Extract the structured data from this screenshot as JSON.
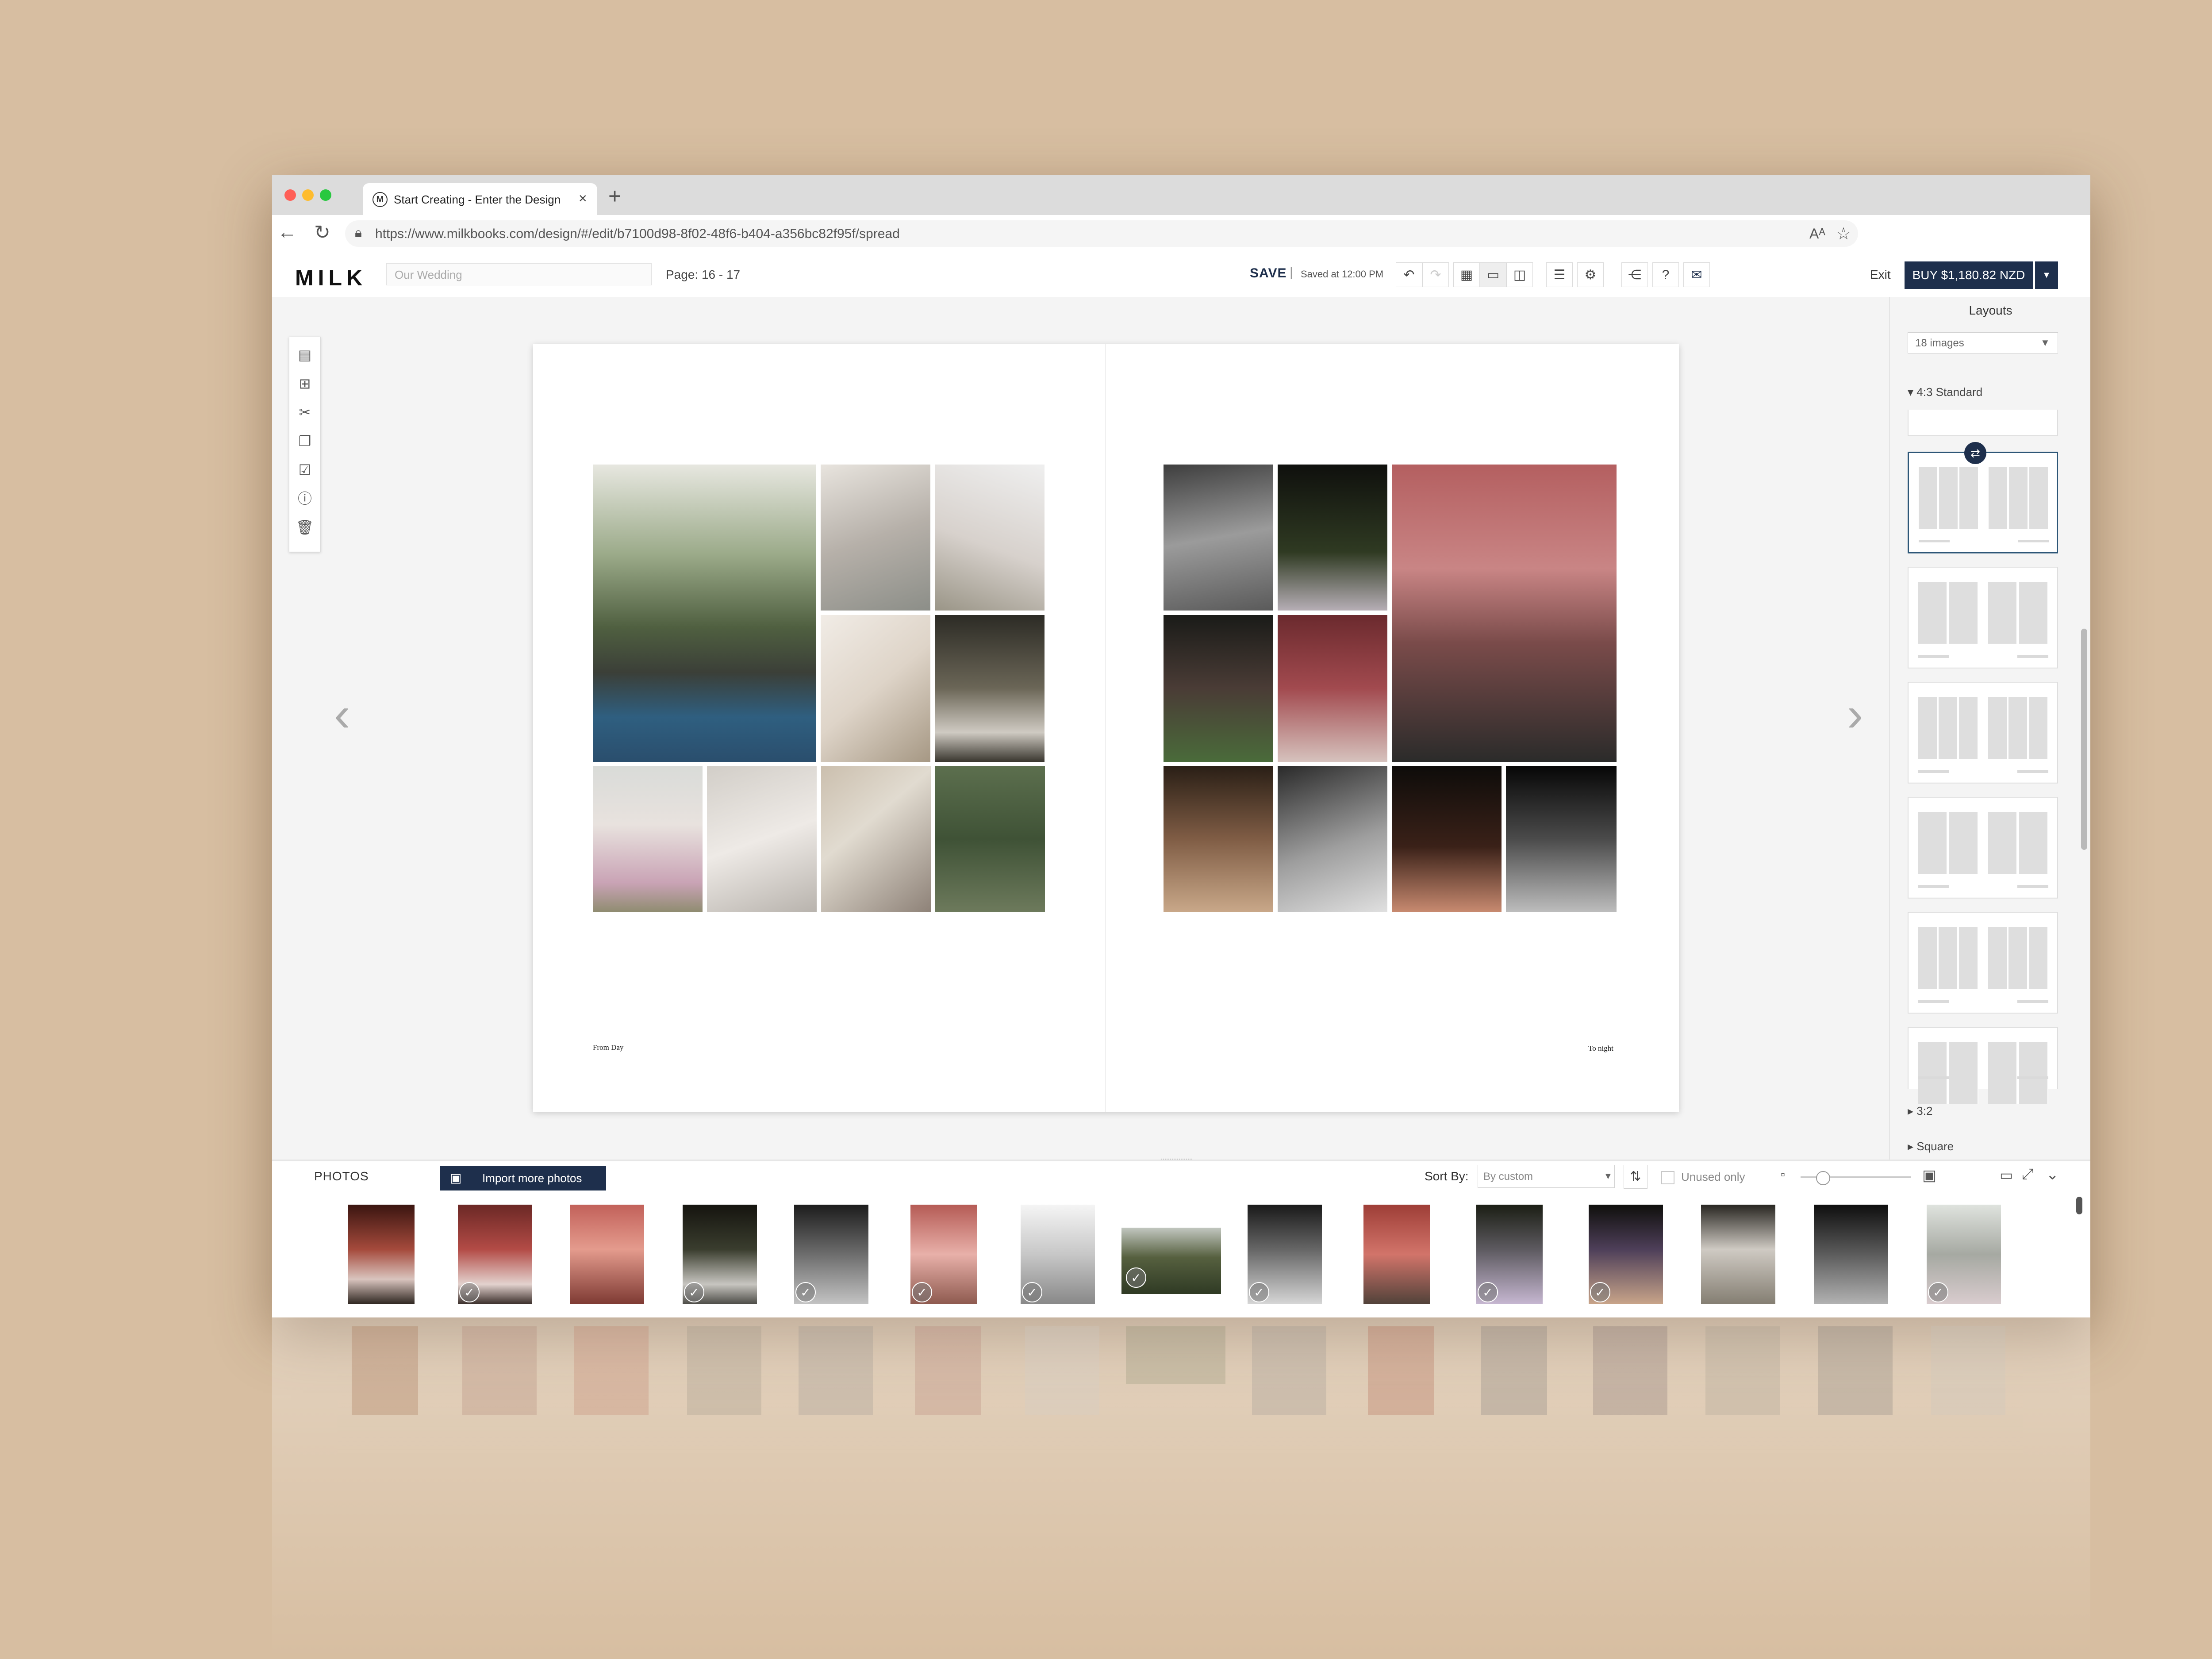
{
  "browser": {
    "tab_title": "Start Creating - Enter the Design",
    "tab_favicon": "M",
    "url": "https://www.milkbooks.com/design/#/edit/b7100d98-8f02-48f6-b404-a356bc82f95f/spread"
  },
  "header": {
    "logo": "MILK",
    "book_title_placeholder": "Our Wedding",
    "page_indicator": "Page: 16 - 17",
    "save_label": "SAVE",
    "separator": "|",
    "saved_time": "Saved at 12:00 PM",
    "exit_label": "Exit",
    "buy_label": "BUY $1,180.82 NZD"
  },
  "spread": {
    "caption_left": "From Day",
    "caption_right": "To night"
  },
  "layouts_panel": {
    "title": "Layouts",
    "image_count_select": "18 images",
    "group_standard": "4:3 Standard",
    "group_32": "3:2",
    "group_square": "Square"
  },
  "photos_tray": {
    "title": "PHOTOS",
    "import_label": "Import more photos",
    "sort_label": "Sort By:",
    "sort_value": "By custom",
    "unused_label": "Unused only"
  },
  "colors": {
    "background": "#d7bea1",
    "brand_navy": "#1e2f4c",
    "selected_layout": "#2d5677"
  }
}
